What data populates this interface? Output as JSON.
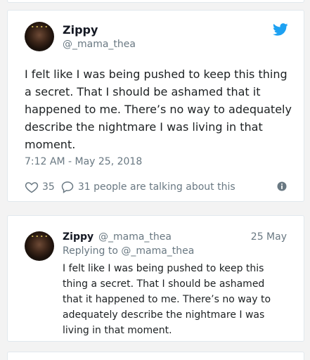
{
  "embed": {
    "author_name": "Zippy",
    "author_handle": "@_mama_thea",
    "text": "I felt like I was being pushed to keep this thing a secret. That I should be ashamed that it happened to me. There’s no way to adequately describe the nightmare I was living in that moment.",
    "timestamp": "7:12 AM - May 25, 2018",
    "likes": "35",
    "talking": "31 people are talking about this"
  },
  "reply": {
    "author_name": "Zippy",
    "author_handle": "@_mama_thea",
    "date": "25 May",
    "replying_to": "Replying to @_mama_thea",
    "text": "I felt like I was being pushed to keep this thing a secret. That I should be ashamed that it happened to me. There’s no way to adequately describe the nightmare I was living in that moment."
  },
  "colors": {
    "twitter_blue": "#1da1f2",
    "muted_text": "#697882",
    "card_border": "#e1e8ed"
  },
  "icons": [
    "twitter-bird-icon",
    "heart-icon",
    "comment-icon",
    "info-icon"
  ]
}
